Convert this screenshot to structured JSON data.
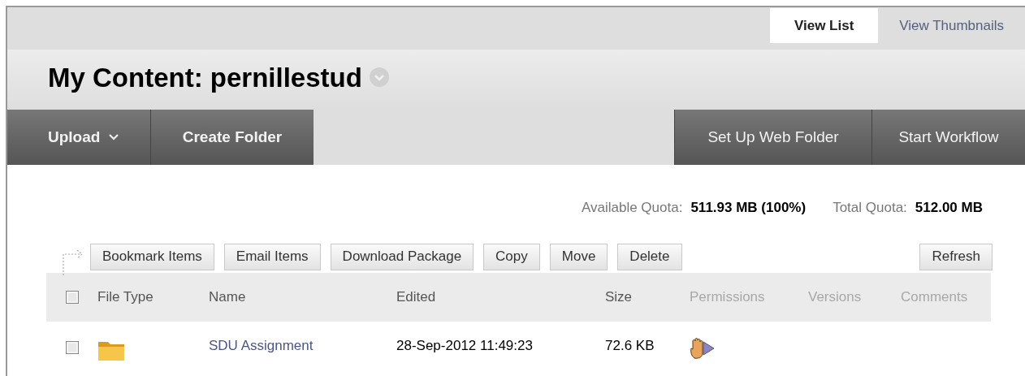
{
  "view_tabs": [
    {
      "label": "View List",
      "selected": true
    },
    {
      "label": "View Thumbnails",
      "selected": false
    }
  ],
  "title": "My Content: pernillestud",
  "action_bar": {
    "left": [
      {
        "label": "Upload",
        "menu": true
      },
      {
        "label": "Create Folder",
        "menu": false
      }
    ],
    "right": [
      {
        "label": "Set Up Web Folder"
      },
      {
        "label": "Start Workflow"
      }
    ]
  },
  "quota": {
    "available_label": "Available Quota:",
    "available_value": "511.93 MB (100%)",
    "total_label": "Total Quota:",
    "total_value": "512.00 MB"
  },
  "toolbar": {
    "buttons": [
      "Bookmark Items",
      "Email Items",
      "Download Package",
      "Copy",
      "Move",
      "Delete"
    ],
    "refresh": "Refresh"
  },
  "table": {
    "select_all_checked": false,
    "columns": [
      {
        "label": "File Type",
        "sortable": true
      },
      {
        "label": "Name",
        "sortable": true
      },
      {
        "label": "Edited",
        "sortable": true
      },
      {
        "label": "Size",
        "sortable": true
      },
      {
        "label": "Permissions",
        "sortable": false
      },
      {
        "label": "Versions",
        "sortable": false
      },
      {
        "label": "Comments",
        "sortable": false
      }
    ],
    "rows": [
      {
        "checked": false,
        "kind": "folder",
        "name": "SDU Assignment",
        "edited": "28-Sep-2012 11:49:23",
        "size": "72.6 KB"
      }
    ]
  }
}
